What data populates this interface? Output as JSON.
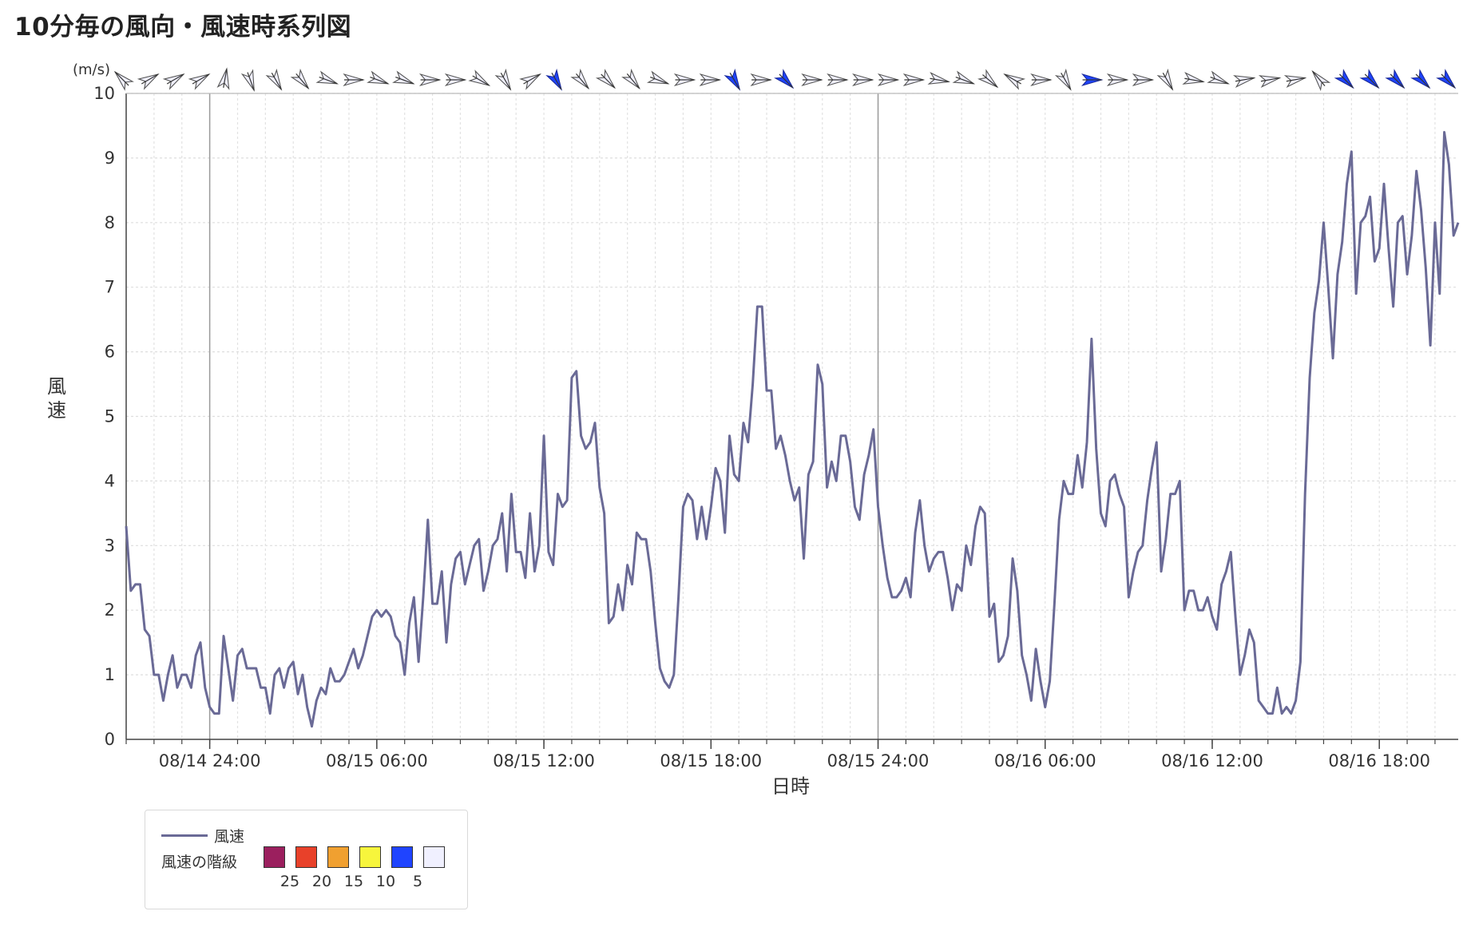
{
  "title": "10分毎の風向・風速時系列図",
  "chart_data": {
    "type": "line",
    "xlabel": "日時",
    "ylabel": "風速",
    "unit": "(m/s)",
    "ylim": [
      0,
      10
    ],
    "yticks": [
      0,
      1,
      2,
      3,
      4,
      5,
      6,
      7,
      8,
      9,
      10
    ],
    "x_start": "08/14 21:00",
    "x_end": "08/16 20:50",
    "interval_minutes": 10,
    "xticks": [
      "08/14 24:00",
      "08/15 06:00",
      "08/15 12:00",
      "08/15 18:00",
      "08/15 24:00",
      "08/16 06:00",
      "08/16 12:00",
      "08/16 18:00"
    ],
    "grid": true,
    "series": [
      {
        "name": "風速",
        "color": "#6a6a96",
        "values": [
          3.3,
          2.3,
          2.4,
          2.4,
          1.7,
          1.6,
          1.0,
          1.0,
          0.6,
          1.0,
          1.3,
          0.8,
          1.0,
          1.0,
          0.8,
          1.3,
          1.5,
          0.8,
          0.5,
          0.4,
          0.4,
          1.6,
          1.1,
          0.6,
          1.3,
          1.4,
          1.1,
          1.1,
          1.1,
          0.8,
          0.8,
          0.4,
          1.0,
          1.1,
          0.8,
          1.1,
          1.2,
          0.7,
          1.0,
          0.5,
          0.2,
          0.6,
          0.8,
          0.7,
          1.1,
          0.9,
          0.9,
          1.0,
          1.2,
          1.4,
          1.1,
          1.3,
          1.6,
          1.9,
          2.0,
          1.9,
          2.0,
          1.9,
          1.6,
          1.5,
          1.0,
          1.8,
          2.2,
          1.2,
          2.2,
          3.4,
          2.1,
          2.1,
          2.6,
          1.5,
          2.4,
          2.8,
          2.9,
          2.4,
          2.7,
          3.0,
          3.1,
          2.3,
          2.6,
          3.0,
          3.1,
          3.5,
          2.6,
          3.8,
          2.9,
          2.9,
          2.5,
          3.5,
          2.6,
          3.0,
          4.7,
          2.9,
          2.7,
          3.8,
          3.6,
          3.7,
          5.6,
          5.7,
          4.7,
          4.5,
          4.6,
          4.9,
          3.9,
          3.5,
          1.8,
          1.9,
          2.4,
          2.0,
          2.7,
          2.4,
          3.2,
          3.1,
          3.1,
          2.6,
          1.8,
          1.1,
          0.9,
          0.8,
          1.0,
          2.2,
          3.6,
          3.8,
          3.7,
          3.1,
          3.6,
          3.1,
          3.6,
          4.2,
          4.0,
          3.2,
          4.7,
          4.1,
          4.0,
          4.9,
          4.6,
          5.5,
          6.7,
          6.7,
          5.4,
          5.4,
          4.5,
          4.7,
          4.4,
          4.0,
          3.7,
          3.9,
          2.8,
          4.1,
          4.3,
          5.8,
          5.5,
          3.9,
          4.3,
          4.0,
          4.7,
          4.7,
          4.3,
          3.6,
          3.4,
          4.1,
          4.4,
          4.8,
          3.6,
          3.0,
          2.5,
          2.2,
          2.2,
          2.3,
          2.5,
          2.2,
          3.2,
          3.7,
          3.0,
          2.6,
          2.8,
          2.9,
          2.9,
          2.5,
          2.0,
          2.4,
          2.3,
          3.0,
          2.7,
          3.3,
          3.6,
          3.5,
          1.9,
          2.1,
          1.2,
          1.3,
          1.6,
          2.8,
          2.3,
          1.3,
          1.0,
          0.6,
          1.4,
          0.9,
          0.5,
          0.9,
          2.1,
          3.4,
          4.0,
          3.8,
          3.8,
          4.4,
          3.9,
          4.6,
          6.2,
          4.5,
          3.5,
          3.3,
          4.0,
          4.1,
          3.8,
          3.6,
          2.2,
          2.6,
          2.9,
          3.0,
          3.7,
          4.2,
          4.6,
          2.6,
          3.1,
          3.8,
          3.8,
          4.0,
          2.0,
          2.3,
          2.3,
          2.0,
          2.0,
          2.2,
          1.9,
          1.7,
          2.4,
          2.6,
          2.9,
          1.9,
          1.0,
          1.3,
          1.7,
          1.5,
          0.6,
          0.5,
          0.4,
          0.4,
          0.8,
          0.4,
          0.5,
          0.4,
          0.6,
          1.2,
          3.8,
          5.6,
          6.6,
          7.1,
          8.0,
          7.0,
          5.9,
          7.2,
          7.7,
          8.6,
          9.1,
          6.9,
          8.0,
          8.1,
          8.4,
          7.4,
          7.6,
          8.6,
          7.6,
          6.7,
          8.0,
          8.1,
          7.2,
          7.8,
          8.8,
          8.2,
          7.3,
          6.1,
          8.0,
          6.9,
          9.4,
          8.9,
          7.8,
          8.0
        ]
      }
    ],
    "direction_markers_note": "wind barbs shown above plot area (hourly)",
    "direction_markers": [
      {
        "deg": 315,
        "speed": 3.3
      },
      {
        "deg": 60,
        "speed": 1.0
      },
      {
        "deg": 60,
        "speed": 1.0
      },
      {
        "deg": 60,
        "speed": 1.2
      },
      {
        "deg": 10,
        "speed": 1.4
      },
      {
        "deg": 160,
        "speed": 1.0
      },
      {
        "deg": 150,
        "speed": 0.8
      },
      {
        "deg": 140,
        "speed": 0.8
      },
      {
        "deg": 110,
        "speed": 1.3
      },
      {
        "deg": 90,
        "speed": 1.9
      },
      {
        "deg": 110,
        "speed": 1.6
      },
      {
        "deg": 110,
        "speed": 2.2
      },
      {
        "deg": 90,
        "speed": 2.4
      },
      {
        "deg": 90,
        "speed": 3.0
      },
      {
        "deg": 120,
        "speed": 3.5
      },
      {
        "deg": 150,
        "speed": 2.6
      },
      {
        "deg": 60,
        "speed": 3.8
      },
      {
        "deg": 150,
        "speed": 5.6
      },
      {
        "deg": 140,
        "speed": 3.5
      },
      {
        "deg": 135,
        "speed": 2.4
      },
      {
        "deg": 140,
        "speed": 1.8
      },
      {
        "deg": 110,
        "speed": 2.2
      },
      {
        "deg": 90,
        "speed": 3.1
      },
      {
        "deg": 90,
        "speed": 4.1
      },
      {
        "deg": 150,
        "speed": 5.4
      },
      {
        "deg": 90,
        "speed": 3.7
      },
      {
        "deg": 135,
        "speed": 5.5
      },
      {
        "deg": 90,
        "speed": 4.7
      },
      {
        "deg": 90,
        "speed": 4.4
      },
      {
        "deg": 90,
        "speed": 3.0
      },
      {
        "deg": 90,
        "speed": 2.5
      },
      {
        "deg": 90,
        "speed": 2.9
      },
      {
        "deg": 100,
        "speed": 2.4
      },
      {
        "deg": 110,
        "speed": 3.3
      },
      {
        "deg": 130,
        "speed": 1.3
      },
      {
        "deg": 300,
        "speed": 1.0
      },
      {
        "deg": 90,
        "speed": 0.9
      },
      {
        "deg": 150,
        "speed": 3.8
      },
      {
        "deg": 90,
        "speed": 6.2
      },
      {
        "deg": 90,
        "speed": 4.0
      },
      {
        "deg": 90,
        "speed": 2.2
      },
      {
        "deg": 150,
        "speed": 4.6
      },
      {
        "deg": 100,
        "speed": 3.8
      },
      {
        "deg": 110,
        "speed": 2.3
      },
      {
        "deg": 80,
        "speed": 1.9
      },
      {
        "deg": 80,
        "speed": 1.0
      },
      {
        "deg": 80,
        "speed": 0.5
      },
      {
        "deg": 320,
        "speed": 0.6
      },
      {
        "deg": 135,
        "speed": 5.6
      },
      {
        "deg": 135,
        "speed": 7.7
      },
      {
        "deg": 135,
        "speed": 8.4
      },
      {
        "deg": 135,
        "speed": 6.7
      },
      {
        "deg": 135,
        "speed": 8.8
      }
    ]
  },
  "legend": {
    "series_label": "風速",
    "scale_label": "風速の階級",
    "classes": [
      {
        "color": "#9b1f5e",
        "label": "25"
      },
      {
        "color": "#e8412a",
        "label": "20"
      },
      {
        "color": "#f0a030",
        "label": "15"
      },
      {
        "color": "#f7f53c",
        "label": "10"
      },
      {
        "color": "#1f44ff",
        "label": "5"
      },
      {
        "color": "#f0f0ff",
        "label": ""
      }
    ]
  }
}
